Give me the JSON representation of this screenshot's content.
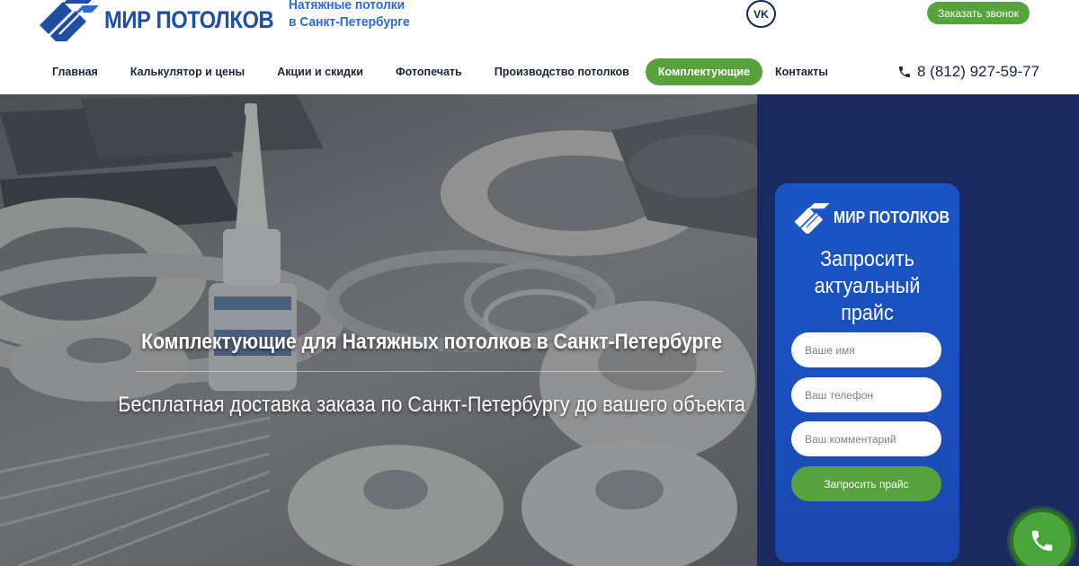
{
  "header": {
    "logo_text": "МИР ПОТОЛКОВ",
    "tagline_line1": "Натяжные потолки",
    "tagline_line2": "в Санкт-Петербурге",
    "vk_label": "VK",
    "callback_label": "Заказать звонок",
    "phone": "8 (812) 927-59-77"
  },
  "nav": {
    "items": [
      {
        "label": "Главная"
      },
      {
        "label": "Калькулятор и цены"
      },
      {
        "label": "Акции и скидки"
      },
      {
        "label": "Фотопечать"
      },
      {
        "label": "Производство потолков"
      },
      {
        "label": "Комплектующие",
        "active": true
      },
      {
        "label": "Контакты"
      }
    ]
  },
  "hero": {
    "title": "Комплектующие для Натяжных потолков в Санкт-Петербурге",
    "subtitle": "Бесплатная доставка заказа по Санкт-Петербургу до вашего объекта"
  },
  "form": {
    "logo_text": "МИР ПОТОЛКОВ",
    "title_line1": "Запросить",
    "title_line2": "актуальный",
    "title_line3": "прайс",
    "name_placeholder": "Ваше имя",
    "phone_placeholder": "Ваш телефон",
    "comment_placeholder": "Ваш комментарий",
    "submit_label": "Запросить прайс"
  },
  "colors": {
    "brand_blue": "#1f4fa3",
    "accent_green": "#58a23d",
    "side_navy": "#1a2a5e",
    "card_blue": "#1a55c6"
  },
  "icons": {
    "logo": "stripes-logo-icon",
    "vk": "vk-icon",
    "phone": "phone-icon",
    "float_call": "phone-call-icon"
  }
}
